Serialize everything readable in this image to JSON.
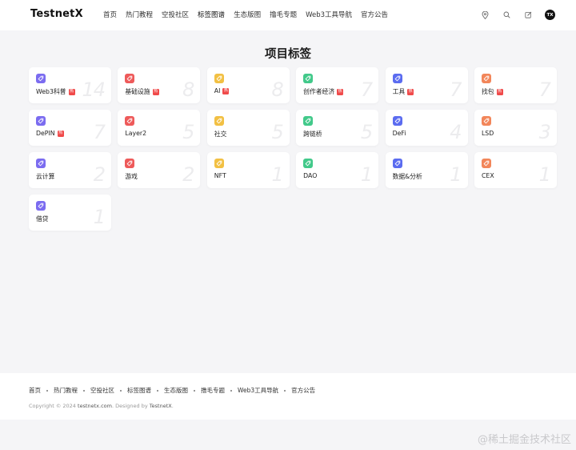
{
  "header": {
    "logo": "TestnetX",
    "nav": [
      "首页",
      "热门教程",
      "空投社区",
      "标签图谱",
      "生态版图",
      "撸毛专题",
      "Web3工具导航",
      "官方公告"
    ],
    "avatar_text": "TX"
  },
  "page_title": "项目标签",
  "hot_badge": "热",
  "tags": [
    {
      "label": "Web3科普",
      "count": "14",
      "hot": true,
      "color": "#7b6cf0"
    },
    {
      "label": "基础设施",
      "count": "8",
      "hot": true,
      "color": "#ee5a5a"
    },
    {
      "label": "AI",
      "count": "8",
      "hot": true,
      "color": "#f2c043"
    },
    {
      "label": "创作者经济",
      "count": "7",
      "hot": true,
      "color": "#42c98a"
    },
    {
      "label": "工具",
      "count": "7",
      "hot": true,
      "color": "#5b6cf0"
    },
    {
      "label": "找包",
      "count": "7",
      "hot": true,
      "color": "#f2865a"
    },
    {
      "label": "DePIN",
      "count": "7",
      "hot": true,
      "color": "#7b6cf0"
    },
    {
      "label": "Layer2",
      "count": "5",
      "hot": false,
      "color": "#ee5a5a"
    },
    {
      "label": "社交",
      "count": "5",
      "hot": false,
      "color": "#f2c043"
    },
    {
      "label": "跨链桥",
      "count": "5",
      "hot": false,
      "color": "#42c98a"
    },
    {
      "label": "DeFi",
      "count": "4",
      "hot": false,
      "color": "#5b6cf0"
    },
    {
      "label": "LSD",
      "count": "3",
      "hot": false,
      "color": "#f2865a"
    },
    {
      "label": "云计算",
      "count": "2",
      "hot": false,
      "color": "#7b6cf0"
    },
    {
      "label": "游戏",
      "count": "2",
      "hot": false,
      "color": "#ee5a5a"
    },
    {
      "label": "NFT",
      "count": "1",
      "hot": false,
      "color": "#f2c043"
    },
    {
      "label": "DAO",
      "count": "1",
      "hot": false,
      "color": "#42c98a"
    },
    {
      "label": "数据&分析",
      "count": "1",
      "hot": false,
      "color": "#5b6cf0"
    },
    {
      "label": "CEX",
      "count": "1",
      "hot": false,
      "color": "#f2865a"
    },
    {
      "label": "借贷",
      "count": "1",
      "hot": false,
      "color": "#7b6cf0"
    }
  ],
  "footer": {
    "nav": [
      "首页",
      "热门教程",
      "空投社区",
      "标签图谱",
      "生态版图",
      "撸毛专题",
      "Web3工具导航",
      "官方公告"
    ],
    "copyright_prefix": "Copyright © 2024",
    "copyright_site": "testnetx.com",
    "copyright_mid": ". Designed by",
    "copyright_brand": "TestnetX",
    "copyright_end": "."
  },
  "watermark": "@稀土掘金技术社区"
}
